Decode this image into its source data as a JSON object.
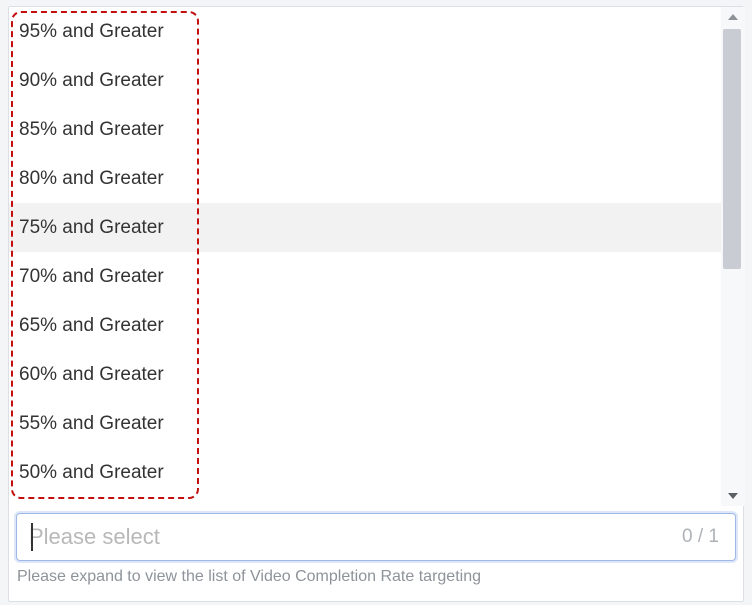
{
  "dropdown": {
    "options": [
      "95% and Greater",
      "90% and Greater",
      "85% and Greater",
      "80% and Greater",
      "75% and Greater",
      "70% and Greater",
      "65% and Greater",
      "60% and Greater",
      "55% and Greater",
      "50% and Greater"
    ],
    "hover_index": 4
  },
  "select": {
    "placeholder": "Please select",
    "value": "",
    "counter": "0 / 1"
  },
  "hint": "Please expand to view the list of Video Completion Rate targeting"
}
